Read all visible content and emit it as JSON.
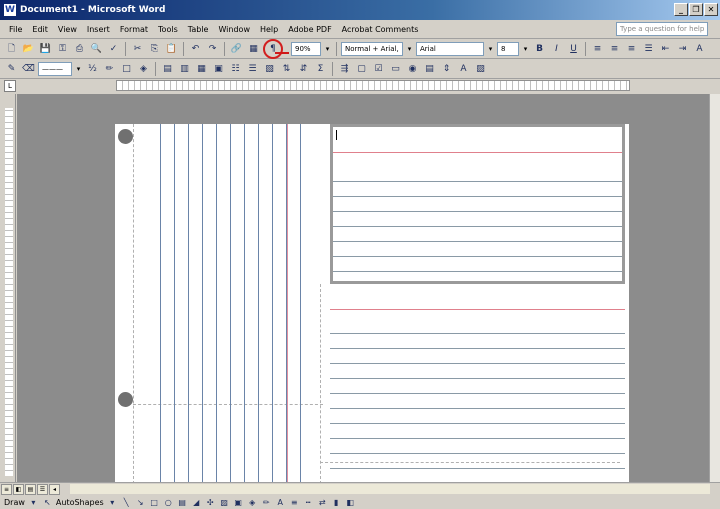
{
  "window": {
    "title": "Document1 - Microsoft Word",
    "app_icon": "W"
  },
  "menu": {
    "items": [
      "File",
      "Edit",
      "View",
      "Insert",
      "Format",
      "Tools",
      "Table",
      "Window",
      "Help",
      "Adobe PDF",
      "Acrobat Comments"
    ],
    "help_placeholder": "Type a question for help"
  },
  "toolbar": {
    "zoom": "90%",
    "style": "Normal + Arial,",
    "font": "Arial",
    "size": "8",
    "bold": "B",
    "italic": "I",
    "underline": "U",
    "pilcrow": "¶"
  },
  "drawing": {
    "draw_label": "Draw",
    "autoshapes_label": "AutoShapes"
  },
  "highlight_color": "#d21e1e"
}
